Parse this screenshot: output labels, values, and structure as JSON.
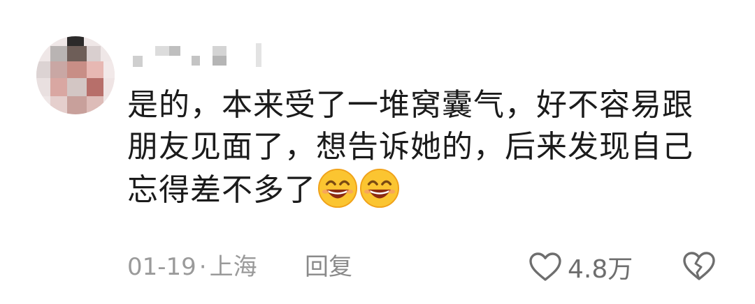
{
  "comment": {
    "text_lines": [
      "是的，本来受了一堆窝囊气，好不容易跟",
      "朋友见面了，想告诉她的，后来发现自己",
      "忘得差不多了"
    ],
    "emojis": [
      "grinning-face-icon",
      "grinning-face-icon"
    ],
    "date": "01-19",
    "separator": "·",
    "location": "上海",
    "reply_label": "回复",
    "like_count": "4.8万"
  },
  "colors": {
    "text": "#1b1b1b",
    "meta": "#9a9a9a",
    "icon": "#6e6e6e",
    "emoji_face": "#fbc531"
  }
}
